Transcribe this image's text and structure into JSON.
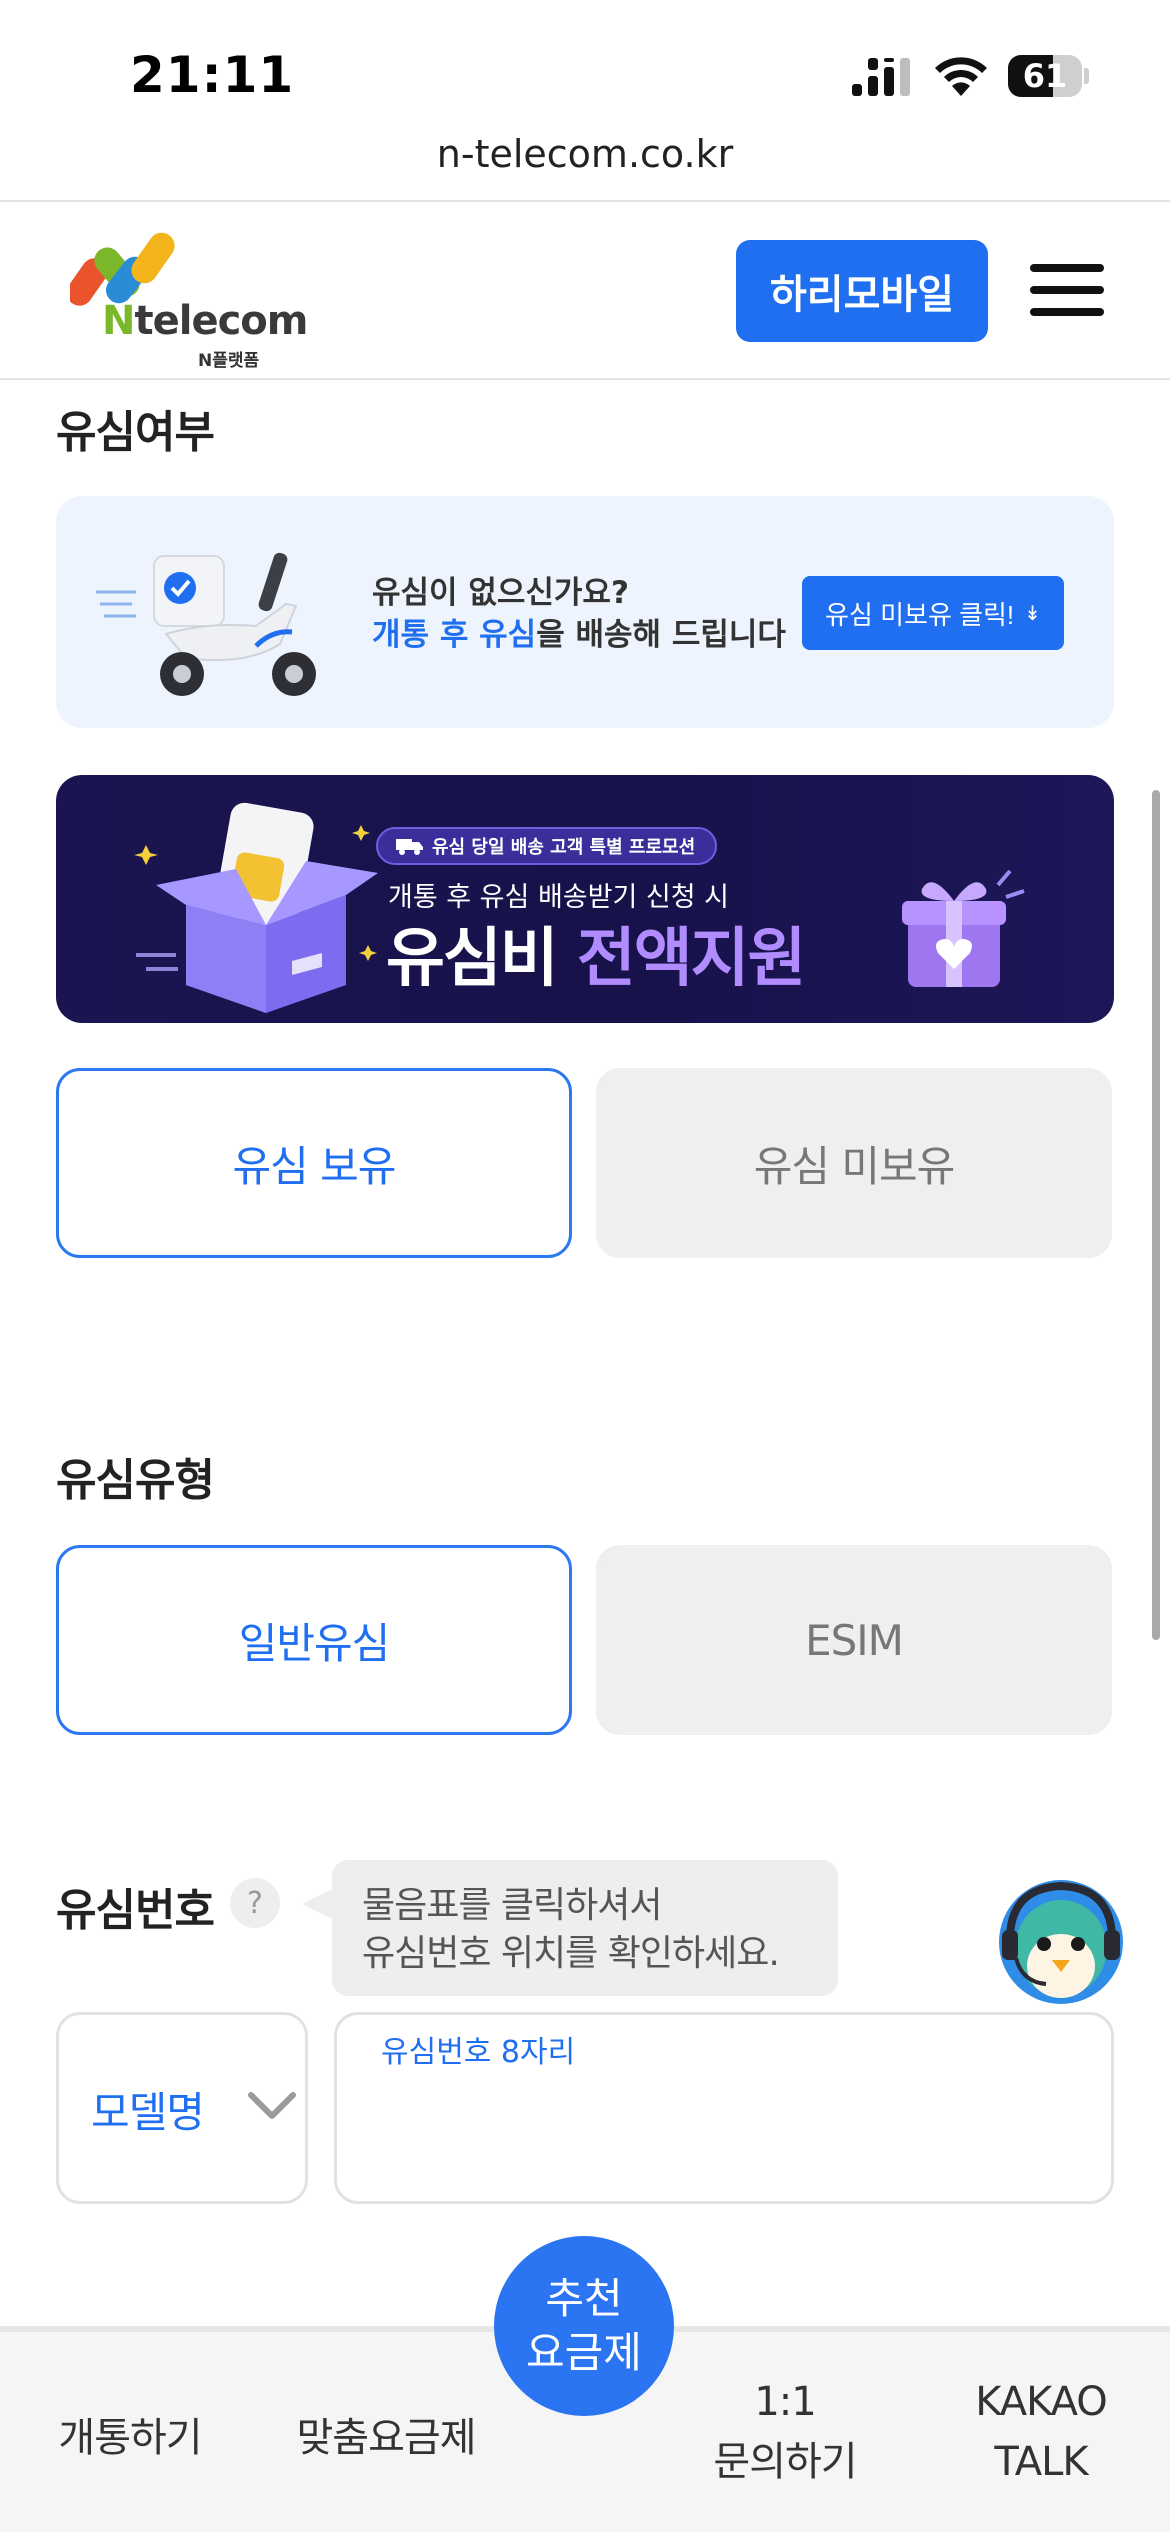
{
  "status_bar": {
    "time": "21:11",
    "battery_level": "61",
    "battery_fraction": 0.61
  },
  "browser": {
    "url": "n-telecom.co.kr"
  },
  "header": {
    "logo_text_n": "N",
    "logo_text_rest": "telecom",
    "logo_sub": "N플랫폼",
    "brand_button": "하리모바일",
    "menu_icon": "hamburger-menu-icon"
  },
  "sim_possession": {
    "heading": "유심여부",
    "notice": {
      "line1": "유심이 없으신가요?",
      "line2_highlight": "개통 후 유심",
      "line2_rest": "을 배송해 드립니다",
      "button": "유심 미보유 클릭!",
      "button_icon": "double-chevron-down-icon"
    },
    "promo": {
      "pill": "유심 당일 배송 고객 특별 프로모션",
      "subtitle": "개통 후 유심 배송받기 신청 시",
      "title_plain": "유심비 ",
      "title_accent": "전액지원"
    },
    "options": [
      {
        "label": "유심 보유",
        "selected": true
      },
      {
        "label": "유심 미보유",
        "selected": false
      }
    ]
  },
  "sim_type": {
    "heading": "유심유형",
    "options": [
      {
        "label": "일반유심",
        "selected": true
      },
      {
        "label": "ESIM",
        "selected": false
      }
    ]
  },
  "sim_number": {
    "heading": "유심번호",
    "help_symbol": "?",
    "tooltip_line1": "물음표를 클릭하셔서",
    "tooltip_line2": "유심번호 위치를 확인하세요.",
    "model_select": "모델명",
    "input_label": "유심번호 8자리",
    "input_value": ""
  },
  "bottom_nav": {
    "items": [
      {
        "label": "개통하기"
      },
      {
        "label": "맞춤요금제"
      },
      {
        "label_line1": "1:1",
        "label_line2": "문의하기"
      },
      {
        "label_line1": "KAKAO",
        "label_line2": "TALK"
      }
    ],
    "fab_line1": "추천",
    "fab_line2": "요금제"
  },
  "colors": {
    "primary": "#1f6ff0",
    "promo_bg": "#17124a",
    "promo_accent": "#b08cff",
    "notice_bg": "#eef4fd",
    "unselected_bg": "#efefef"
  }
}
